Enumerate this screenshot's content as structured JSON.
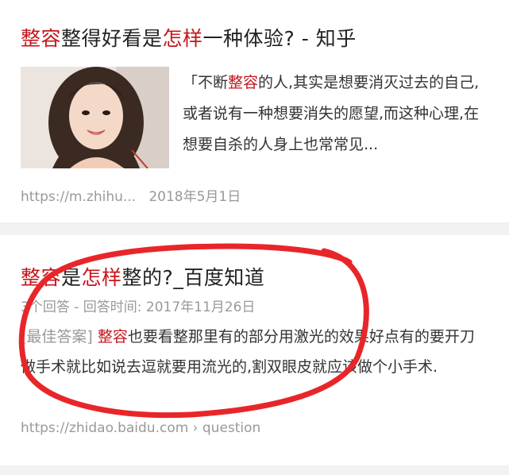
{
  "results": [
    {
      "title_hl1": "整容",
      "title_mid": "整得好看是",
      "title_hl2": "怎样",
      "title_end": "一种体验? - 知乎",
      "snippet_pre": "「不断",
      "snippet_hl": "整容",
      "snippet_post": "的人,其实是想要消灭过去的自己,或者说有一种想要消失的愿望,而这种心理,在想要自杀的人身上也常常见...",
      "url": "https://m.zhihu...",
      "date": "2018年5月1日"
    },
    {
      "title_hl1": "整容",
      "title_mid": "是",
      "title_hl2": "怎样",
      "title_end": "整的?_百度知道",
      "answers": "3个回答",
      "answer_time": " - 回答时间: 2017年11月26日",
      "best_tag": "[最佳答案]",
      "snippet_hl": "整容",
      "snippet_post": "也要看整那里有的部分用激光的效果好点有的要开刀做手术就比如说去逗就要用流光的,割双眼皮就应该做个小手术.",
      "url": "https://zhidao.baidu.com › question"
    }
  ],
  "colors": {
    "highlight": "#c4161c",
    "annotation_circle": "#e8262a",
    "meta_gray": "#999999"
  }
}
